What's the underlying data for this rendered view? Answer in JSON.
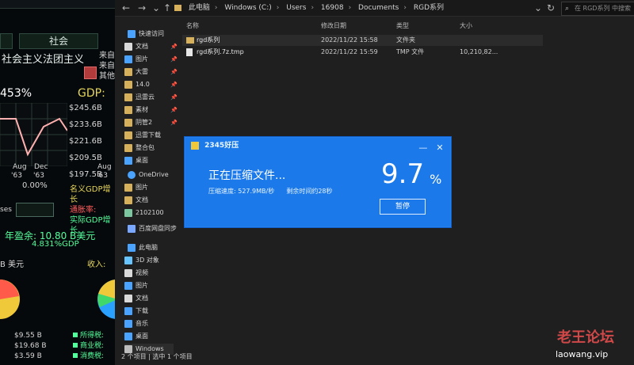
{
  "game": {
    "tab_label": "社会",
    "title": "社会主义法团主义",
    "side_lines": [
      "来自",
      "来自",
      "其他"
    ],
    "pct_top": "453%",
    "gdp_label": "GDP:",
    "y_ticks": [
      "$245.6B",
      "$233.6B",
      "$221.6B",
      "$209.5B",
      "$197.5B"
    ],
    "x_ticks": [
      "Aug",
      "Dec",
      "Aug",
      "'63",
      "'63",
      "'63"
    ],
    "pct_small": "0.00%",
    "left_mid_labels": [
      "名义GDP增长",
      "通胀率:",
      "实际GDP增长"
    ],
    "budget_surplus": "年盈余: 10.80 B美元",
    "budget_pct": "4.831%GDP",
    "b_usd": "B 美元",
    "income_label": "收入:",
    "values_left": [
      "$9.55 B",
      "$19.68 B",
      "$3.59 B"
    ],
    "income_items": [
      "所得税:",
      "商业税:",
      "消费税:"
    ],
    "small_ses": "ses"
  },
  "explorer": {
    "breadcrumbs": [
      "此电脑",
      "Windows (C:)",
      "Users",
      "16908",
      "Documents",
      "RGD系列"
    ],
    "search_placeholder": "在 RGD系列 中搜索",
    "quick_access": {
      "label": "快速访问",
      "items": [
        "文档",
        "图片",
        "大雷",
        "14.0",
        "迅雷云",
        "素材",
        "阴管2",
        "迅雷下载",
        "整合包",
        "桌面"
      ]
    },
    "onedrive": {
      "label": "OneDrive",
      "items": [
        "图片",
        "文档",
        "2102100"
      ]
    },
    "baidu": "百度网盘同步",
    "this_pc": {
      "label": "此电脑",
      "items": [
        "3D 对象",
        "视频",
        "图片",
        "文档",
        "下载",
        "音乐",
        "桌面",
        "Windows"
      ]
    },
    "columns": [
      "名称",
      "修改日期",
      "类型",
      "大小"
    ],
    "rows": [
      {
        "name": "rgd系列",
        "date": "2022/11/22 15:58",
        "type": "文件夹",
        "size": ""
      },
      {
        "name": "rgd系列.7z.tmp",
        "date": "2022/11/22 15:59",
        "type": "TMP 文件",
        "size": "10,210,82..."
      }
    ],
    "status": "2 个项目  |  选中 1 个项目"
  },
  "dialog": {
    "app_logo": "2345好压",
    "title": "正在压缩文件...",
    "speed": "压缩速度: 527.9MB/秒",
    "remaining": "剩余时间约28秒",
    "percent": "9.7",
    "percent_symbol": "%",
    "pause_label": "暂停",
    "progress": 0.097
  },
  "watermark": {
    "title": "老王论坛",
    "domain": "laowang.vip"
  },
  "colors": {
    "explorer_bg": "#1f1f1f",
    "dialog_blue": "#1b79ea",
    "game_green": "#52ff9c",
    "game_yellow": "#e6d65c"
  }
}
